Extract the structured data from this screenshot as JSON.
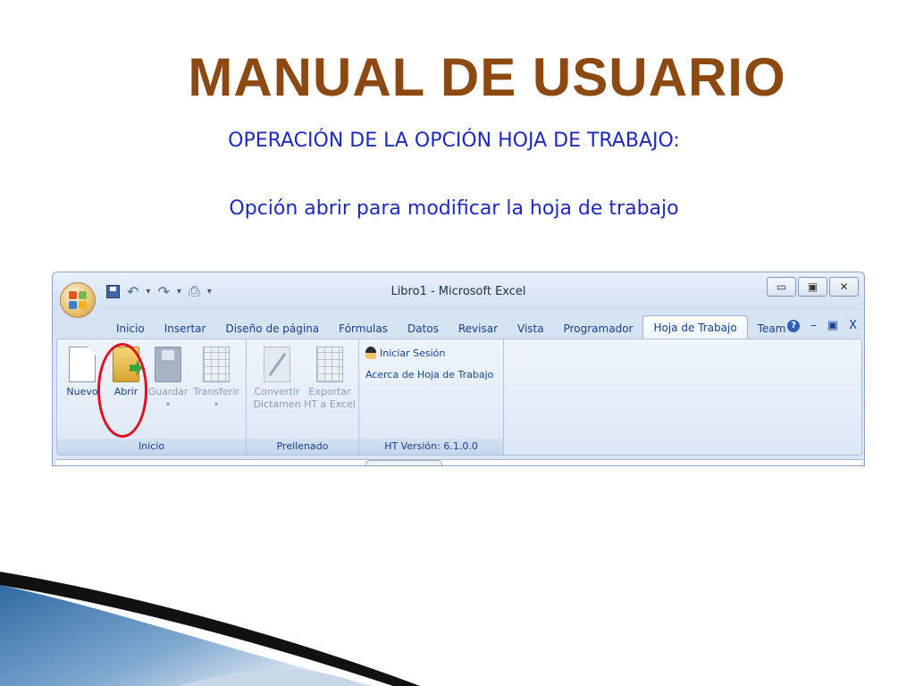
{
  "slide": {
    "title": "MANUAL DE USUARIO",
    "subtitle": "OPERACIÓN DE LA OPCIÓN HOJA DE TRABAJO:",
    "caption": "Opción abrir para modificar la hoja de trabajo"
  },
  "excel": {
    "window_title": "Libro1 - Microsoft Excel",
    "window_controls": [
      "▭",
      "▣",
      "✕"
    ],
    "tabs": [
      "Inicio",
      "Insertar",
      "Diseño de página",
      "Fórmulas",
      "Datos",
      "Revisar",
      "Vista",
      "Programador",
      "Hoja de Trabajo",
      "Team"
    ],
    "active_tab": "Hoja de Trabajo",
    "ribbon_controls": [
      "–",
      "▣",
      "X"
    ],
    "groups": {
      "inicio": {
        "label": "Inicio",
        "nuevo": "Nuevo",
        "abrir": "Abrir",
        "guardar": "Guardar",
        "transferir": "Transferir"
      },
      "prellenado": {
        "label": "Prellenado",
        "convertir_1": "Convertir",
        "convertir_2": "Dictamen",
        "exportar_1": "Exportar",
        "exportar_2": "HT a Excel"
      },
      "sesion": {
        "label": "HT Versión: 6.1.0.0",
        "iniciar": "Iniciar Sesión",
        "acerca": "Acerca de Hoja de Trabajo"
      }
    },
    "icons": {
      "office_button": "office-logo-icon",
      "quick_access": [
        "save-icon",
        "undo-icon",
        "redo-icon",
        "print-preview-icon"
      ],
      "help": "help-icon"
    }
  },
  "colors": {
    "title": "#8c4a12",
    "text_blue": "#1e2bb8",
    "highlight_circle": "#e0101e"
  }
}
